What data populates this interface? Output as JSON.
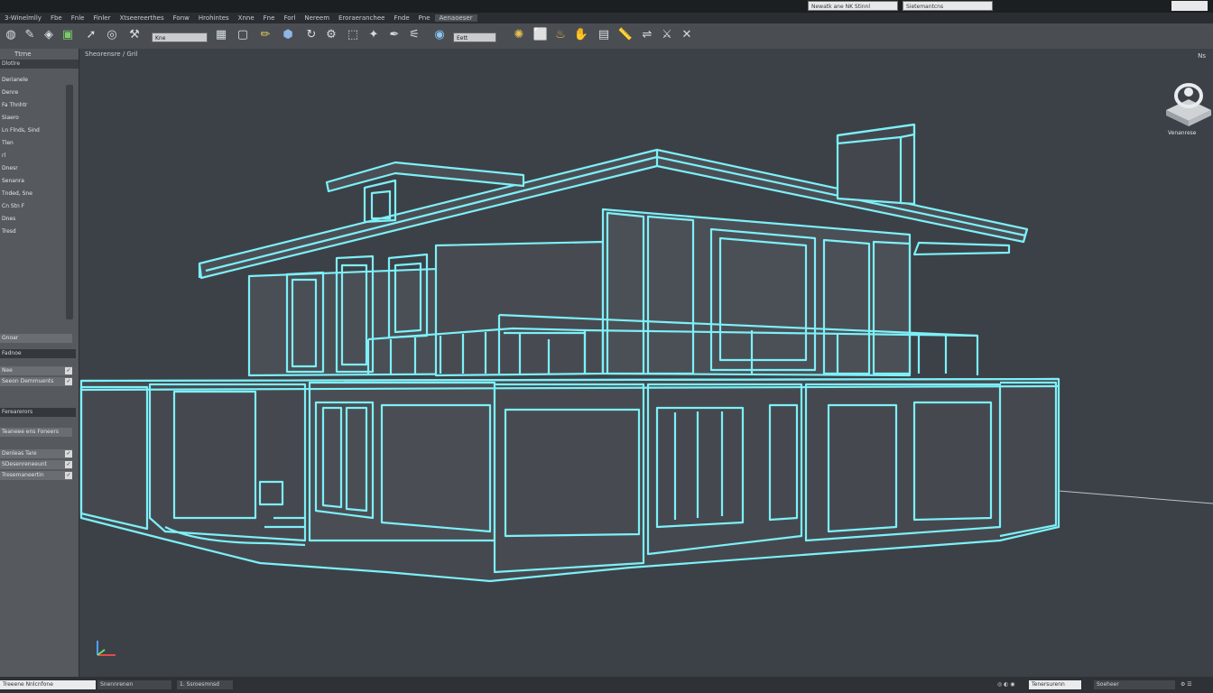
{
  "menu": [
    "3-Winelmlly",
    "Fbe",
    "Fnle",
    "Finler",
    "Xtseereerthes",
    "Fonw",
    "Hrohintes",
    "Xnne",
    "Fne",
    "Forl",
    "Nereem",
    "Eroraeranchee",
    "Fnde",
    "Pne",
    "Aenaoeser"
  ],
  "search": "Newatk ane NK Stinnl",
  "search2": "Sietemantcns",
  "toolbar": {
    "field1": "Kne",
    "field2": "Eett"
  },
  "sidebar": {
    "title": "Ttrne",
    "section": "Dlotlre",
    "items": [
      "Derianele",
      "Denre",
      "Fa Thnhtr",
      "Siaero",
      "Ln Flnds, Sind",
      "Tlen",
      "rl",
      "Dnesr",
      "Senanra",
      "Tnded, Sne",
      "Cn Stn F",
      "Dnes",
      "Tresd"
    ],
    "field_a": "Gnoar",
    "bar_a": "Fadnoe",
    "row_a": "Nee",
    "row_b": "Seeon   Demmuents",
    "bar_b": "Ferearerors",
    "row_c": "Teaneee ens Foneers",
    "row_d": "Denleas Tare",
    "row_e": "SDesenreneeunt",
    "row_f": "Tresemaneertin"
  },
  "viewport": {
    "label": "Sheorensre / Gril",
    "right_label": "Ns",
    "viewcube_label": "Venanrese"
  },
  "status": {
    "left1": "Treeene Nnlcnfone",
    "left2": "Snennrenen",
    "left3": "1. Ssroesmnsd",
    "right1": "Tenersurenn",
    "right2": "Soeheer"
  },
  "colors": {
    "wire": "#7df0f8",
    "viewport_bg": "#3c4147",
    "panel_bg": "#56595d"
  }
}
